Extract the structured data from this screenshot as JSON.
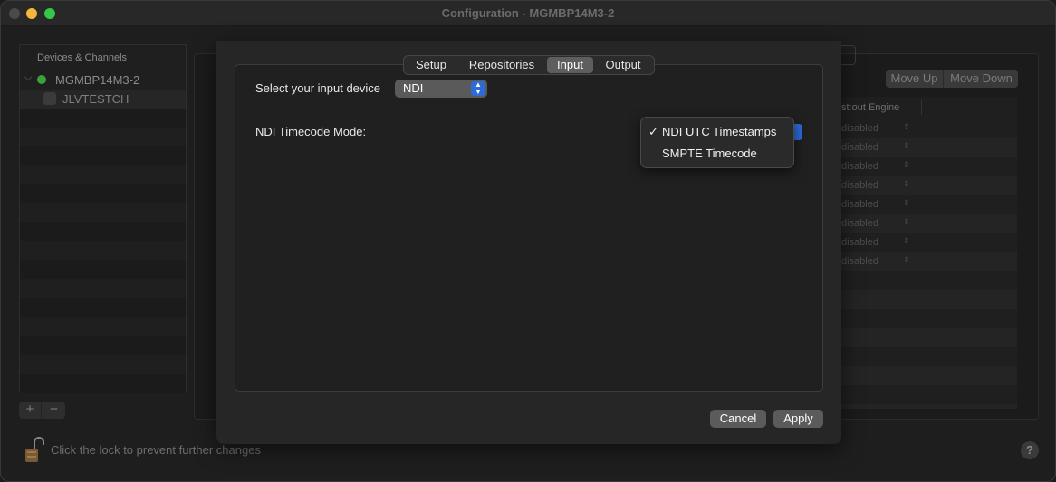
{
  "window": {
    "title": "Configuration - MGMBP14M3-2"
  },
  "devices": {
    "header": "Devices & Channels",
    "device_name": "MGMBP14M3-2",
    "channel_name": "JLVTESTCH",
    "status_color": "#3aa23a"
  },
  "footer": {
    "lock_text": "Click the lock to prevent further changes",
    "help": "?"
  },
  "background": {
    "move_up": "Move Up",
    "move_down": "Move Down",
    "table_header": "st:out Engine",
    "rows": [
      "disabled",
      "disabled",
      "disabled",
      "disabled",
      "disabled",
      "disabled",
      "disabled",
      "disabled"
    ]
  },
  "sheet": {
    "tabs": [
      "Setup",
      "Repositories",
      "Input",
      "Output"
    ],
    "active_tab": "Input",
    "input_label": "Select your input device",
    "input_value": "NDI",
    "timecode_label": "NDI Timecode Mode:",
    "menu": {
      "items": [
        {
          "label": "NDI UTC Timestamps",
          "checked": "✓"
        },
        {
          "label": "SMPTE Timecode",
          "checked": ""
        }
      ]
    },
    "cancel": "Cancel",
    "apply": "Apply"
  },
  "colors": {
    "accent": "#2d6bd9",
    "background": "#1e1e1e"
  }
}
